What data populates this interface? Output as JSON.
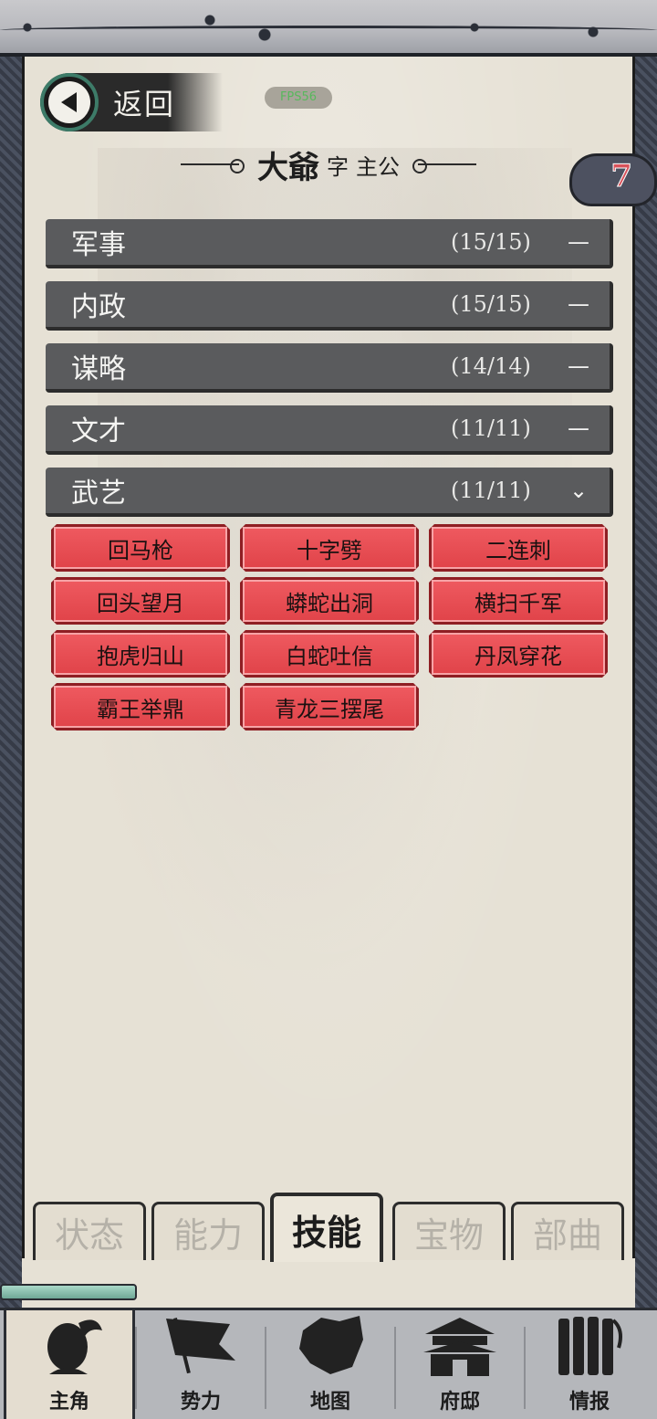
{
  "header": {
    "back_label": "返回",
    "fps_label": "FPS56"
  },
  "title": {
    "name": "大爺",
    "zi": "字",
    "style": "主公"
  },
  "badge": {
    "value": "7"
  },
  "categories": [
    {
      "name": "军事",
      "count": "(15/15)",
      "toggle": "—"
    },
    {
      "name": "内政",
      "count": "(15/15)",
      "toggle": "—"
    },
    {
      "name": "谋略",
      "count": "(14/14)",
      "toggle": "—"
    },
    {
      "name": "文才",
      "count": "(11/11)",
      "toggle": "—"
    },
    {
      "name": "武艺",
      "count": "(11/11)",
      "toggle": "⌄"
    }
  ],
  "skills": [
    "回马枪",
    "十字劈",
    "二连刺",
    "回头望月",
    "蟒蛇出洞",
    "横扫千军",
    "抱虎归山",
    "白蛇吐信",
    "丹凤穿花",
    "霸王举鼎",
    "青龙三摆尾"
  ],
  "sub_tabs": [
    {
      "label": "状态"
    },
    {
      "label": "能力"
    },
    {
      "label": "技能",
      "active": true
    },
    {
      "label": "宝物"
    },
    {
      "label": "部曲"
    }
  ],
  "bottom_nav": [
    {
      "label": "主角",
      "icon": "warrior-icon",
      "active": true
    },
    {
      "label": "势力",
      "icon": "flag-icon"
    },
    {
      "label": "地图",
      "icon": "map-icon"
    },
    {
      "label": "府邸",
      "icon": "mansion-icon"
    },
    {
      "label": "情报",
      "icon": "bamboo-scroll-icon"
    }
  ],
  "colors": {
    "skill_red": "#e04349",
    "category_gray": "#5a5b5d",
    "parchment": "#e6e1d5",
    "accent_green": "#3d7b68"
  }
}
